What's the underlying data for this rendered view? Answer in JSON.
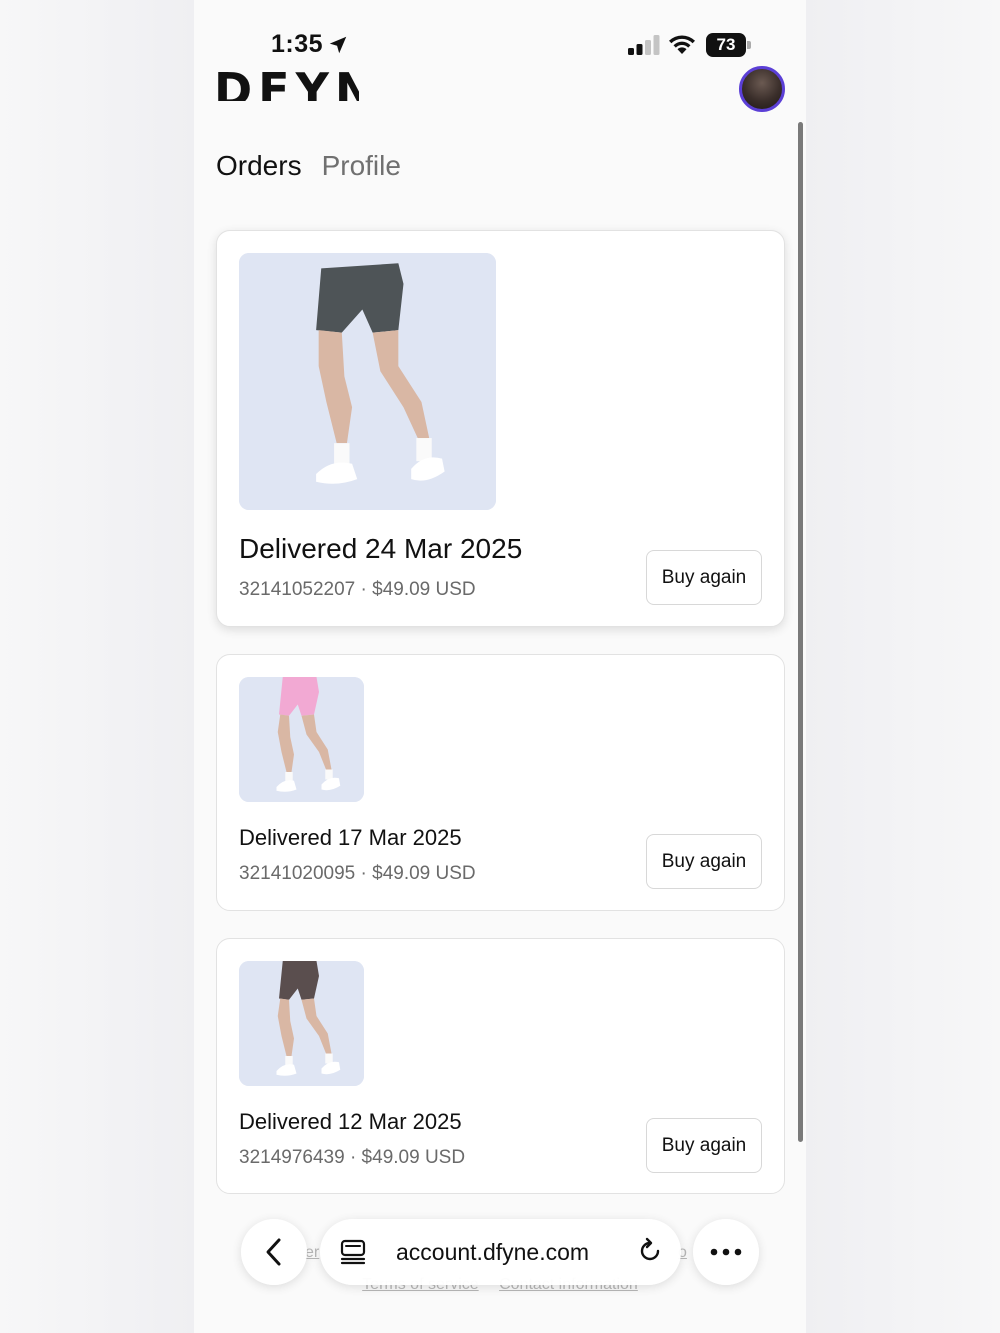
{
  "status_bar": {
    "time": "1:35",
    "battery": "73",
    "icons": [
      "location-arrow-icon",
      "cellular-signal-icon",
      "wifi-icon",
      "battery-icon"
    ]
  },
  "header": {
    "logo_text": "DFYNE",
    "avatar_icon": "profile-avatar"
  },
  "tabs": [
    {
      "label": "Orders",
      "active": true
    },
    {
      "label": "Profile",
      "active": false
    }
  ],
  "orders": [
    {
      "status": "Delivered 24 Mar 2025",
      "meta": "32141052207 · $49.09 USD",
      "button": "Buy again",
      "product_color": "#4e5457"
    },
    {
      "status": "Delivered 17 Mar 2025",
      "meta": "32141020095 · $49.09 USD",
      "button": "Buy again",
      "product_color": "#f2a9d3"
    },
    {
      "status": "Delivered 12 Mar 2025",
      "meta": "3214976439 · $49.09 USD",
      "button": "Buy again",
      "product_color": "#5a4e4e"
    }
  ],
  "footer": {
    "left_fragment": "er",
    "right_fragment": "o",
    "links": [
      "Terms of service",
      "Contact information"
    ]
  },
  "browser": {
    "url": "account.dfyne.com",
    "icons": [
      "back-chevron-icon",
      "reader-mode-icon",
      "reload-icon",
      "more-icon"
    ]
  },
  "colors": {
    "accent_avatar_border": "#5b3fd6",
    "text_primary": "#111111",
    "text_secondary": "#6a6a6a"
  }
}
